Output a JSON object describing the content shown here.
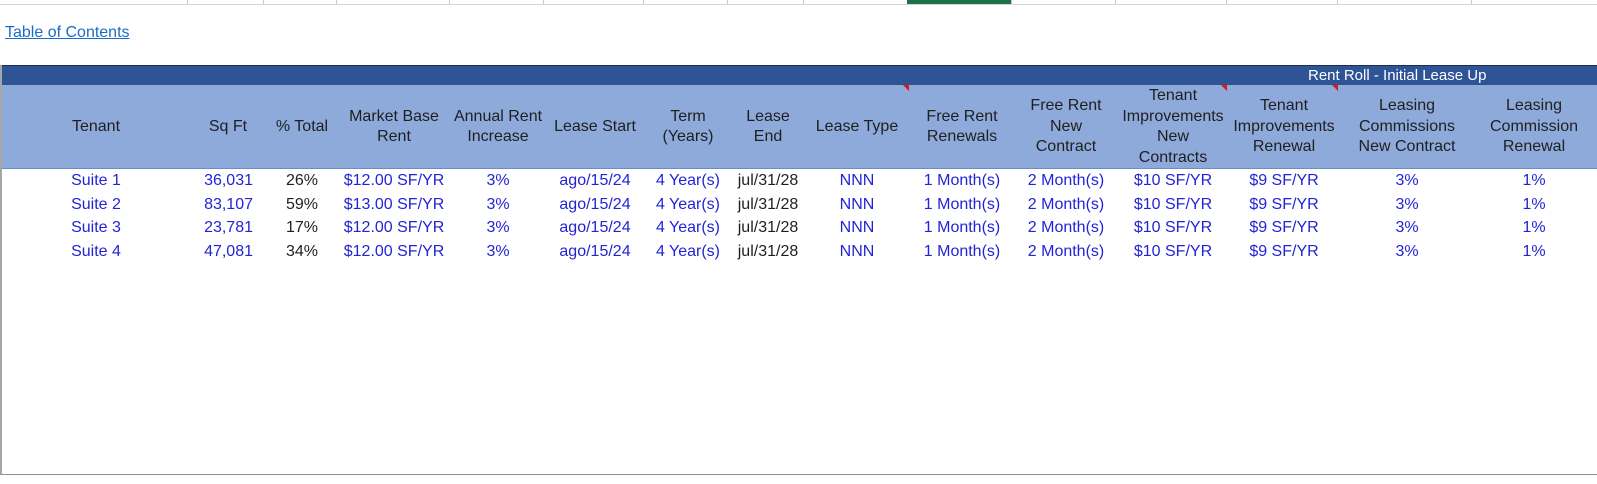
{
  "link": {
    "toc": "Table of Contents"
  },
  "table": {
    "title": "Rent Roll - Initial Lease Up",
    "headers": [
      "Tenant",
      "Sq Ft",
      "% Total",
      "Market Base\nRent",
      "Annual Rent\nIncrease",
      "Lease Start",
      "Term\n(Years)",
      "Lease\nEnd",
      "Lease Type",
      "Free Rent\nRenewals",
      "Free Rent\nNew\nContract",
      "Tenant\nImprovements\nNew\nContracts",
      "Tenant\nImprovements\nRenewal",
      "Leasing\nCommissions\nNew Contract",
      "Leasing\nCommission\nRenewal"
    ],
    "rows": [
      [
        "Suite 1",
        "36,031",
        "26%",
        "$12.00 SF/YR",
        "3%",
        "ago/15/24",
        "4 Year(s)",
        "jul/31/28",
        "NNN",
        "1 Month(s)",
        "2 Month(s)",
        "$10 SF/YR",
        "$9 SF/YR",
        "3%",
        "1%"
      ],
      [
        "Suite 2",
        "83,107",
        "59%",
        "$13.00 SF/YR",
        "3%",
        "ago/15/24",
        "4 Year(s)",
        "jul/31/28",
        "NNN",
        "1 Month(s)",
        "2 Month(s)",
        "$10 SF/YR",
        "$9 SF/YR",
        "3%",
        "1%"
      ],
      [
        "Suite 3",
        "23,781",
        "17%",
        "$12.00 SF/YR",
        "3%",
        "ago/15/24",
        "4 Year(s)",
        "jul/31/28",
        "NNN",
        "1 Month(s)",
        "2 Month(s)",
        "$10 SF/YR",
        "$9 SF/YR",
        "3%",
        "1%"
      ],
      [
        "Suite 4",
        "47,081",
        "34%",
        "$12.00 SF/YR",
        "3%",
        "ago/15/24",
        "4 Year(s)",
        "jul/31/28",
        "NNN",
        "1 Month(s)",
        "2 Month(s)",
        "$10 SF/YR",
        "$9 SF/YR",
        "3%",
        "1%"
      ]
    ]
  },
  "colors": {
    "title_bar": "#2f5496",
    "header_fill": "#8eaadb",
    "input_text": "#2323d6",
    "link": "#1a6cc8",
    "comment_indicator": "#e81123"
  }
}
